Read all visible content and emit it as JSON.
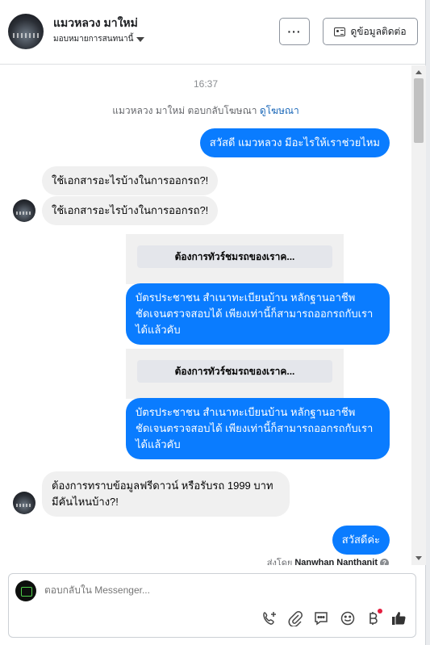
{
  "header": {
    "contact_name": "แมวหลวง มาใหม่",
    "assign_label": "มอบหมายการสนทนานี้",
    "more_label": "···",
    "contact_info_label": "ดูข้อมูลติดต่อ"
  },
  "chat": {
    "timestamp": "16:37",
    "ad_note": "แมวหลวง มาใหม่ ตอบกลับโฆษณา",
    "ad_link": "ดูโฆษณา",
    "msg_out_1": "สวัสดี แมวหลวง มีอะไรให้เราช่วยไหม",
    "msg_in_1": "ใช้เอกสารอะไรบ้างในการออกรถ?!",
    "msg_in_2": "ใช้เอกสารอะไรบ้างในการออกรถ?!",
    "template_button_1": "ต้องการทัวร์ชมรถของเราค...",
    "msg_out_2": "บัตรประชาชน สำเนาทะเบียนบ้าน หลักฐานอาชีพ ชัดเจนตรวจสอบได้ เพียงเท่านี้ก็สามารถออกรถกับเราได้แล้วคับ",
    "template_button_2": "ต้องการทัวร์ชมรถของเราค...",
    "msg_out_3": "บัตรประชาชน สำเนาทะเบียนบ้าน หลักฐานอาชีพ ชัดเจนตรวจสอบได้ เพียงเท่านี้ก็สามารถออกรถกับเราได้แล้วคับ",
    "msg_in_3": "ต้องการทราบข้อมูลฟรีดาวน์ หรือรับรถ 1999 บาท มีคันไหนบ้าง?!",
    "msg_out_4": "สวัสดีค่ะ",
    "sent_by_label": "ส่งโดย",
    "sent_by_name": "Nanwhan Nanthanit"
  },
  "composer": {
    "placeholder": "ตอบกลับใน Messenger..."
  },
  "icons": {
    "tools": [
      "call-add-icon",
      "attachment-icon",
      "saved-reply-icon",
      "emoji-icon",
      "payment-icon",
      "like-icon"
    ]
  },
  "colors": {
    "outgoing_bubble": "#0a7cff",
    "incoming_bubble": "#f0f0f0",
    "link": "#1a67b8",
    "notification_dot": "#e41e3f"
  }
}
